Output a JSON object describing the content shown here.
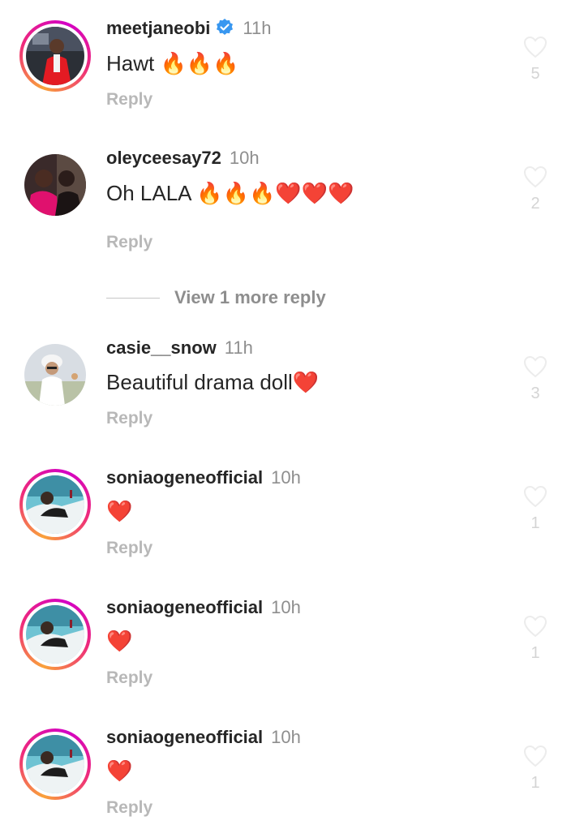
{
  "comments": [
    {
      "username": "meetjaneobi",
      "verified": true,
      "time": "11h",
      "text": "Hawt 🔥🔥🔥",
      "reply_label": "Reply",
      "likes": "5",
      "story_ring": true
    },
    {
      "username": "oleyceesay72",
      "verified": false,
      "time": "10h",
      "text": "Oh LALA 🔥🔥🔥❤️❤️❤️",
      "reply_label": "Reply",
      "likes": "2",
      "story_ring": false
    },
    {
      "username": "casie__snow",
      "verified": false,
      "time": "11h",
      "text": "Beautiful drama doll❤️",
      "reply_label": "Reply",
      "likes": "3",
      "story_ring": false
    },
    {
      "username": "soniaogeneofficial",
      "verified": false,
      "time": "10h",
      "text": "❤️",
      "reply_label": "Reply",
      "likes": "1",
      "story_ring": true
    },
    {
      "username": "soniaogeneofficial",
      "verified": false,
      "time": "10h",
      "text": "❤️",
      "reply_label": "Reply",
      "likes": "1",
      "story_ring": true
    },
    {
      "username": "soniaogeneofficial",
      "verified": false,
      "time": "10h",
      "text": "❤️",
      "reply_label": "Reply",
      "likes": "1",
      "story_ring": true
    }
  ],
  "view_more_replies": "View 1 more reply",
  "icons": {
    "verified": "verified-badge-icon",
    "like": "heart-outline-icon"
  },
  "colors": {
    "verified_blue": "#3897f0",
    "muted_text": "#8e8e8e",
    "reply_text": "#b8b8b8"
  }
}
